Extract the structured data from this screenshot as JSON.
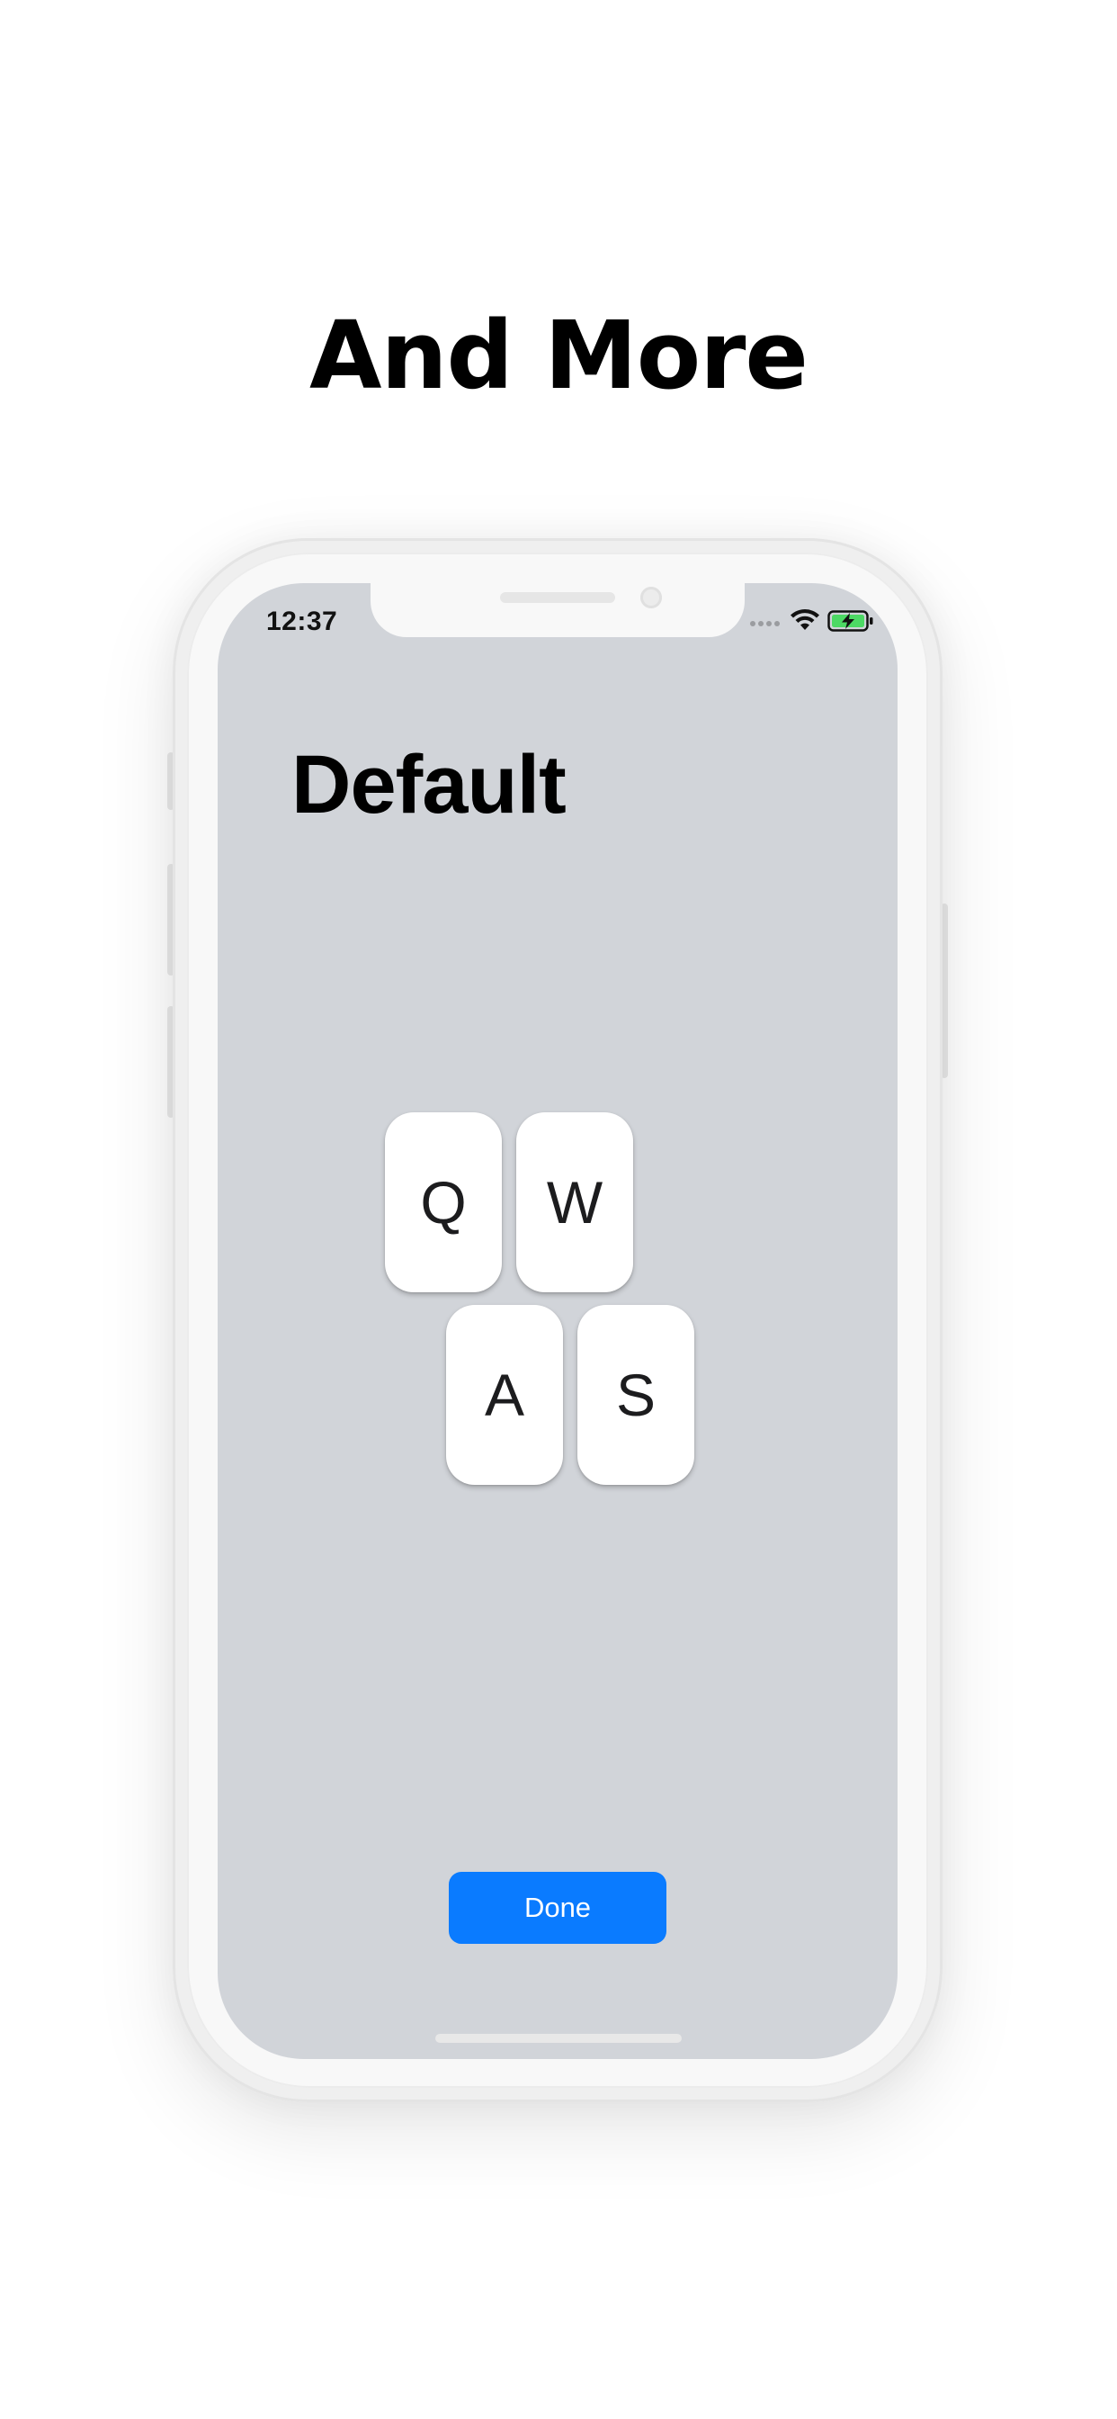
{
  "marketing": {
    "headline": "And More"
  },
  "status_bar": {
    "time": "12:37",
    "icons": [
      "signal-dots-icon",
      "wifi-icon",
      "battery-charging-icon"
    ],
    "battery_color": "#4cd964"
  },
  "screen": {
    "title": "Default",
    "background_color": "#d1d4d9"
  },
  "keys": {
    "row1": [
      "Q",
      "W"
    ],
    "row2": [
      "A",
      "S"
    ]
  },
  "actions": {
    "done_label": "Done",
    "done_color": "#0a7bff"
  }
}
